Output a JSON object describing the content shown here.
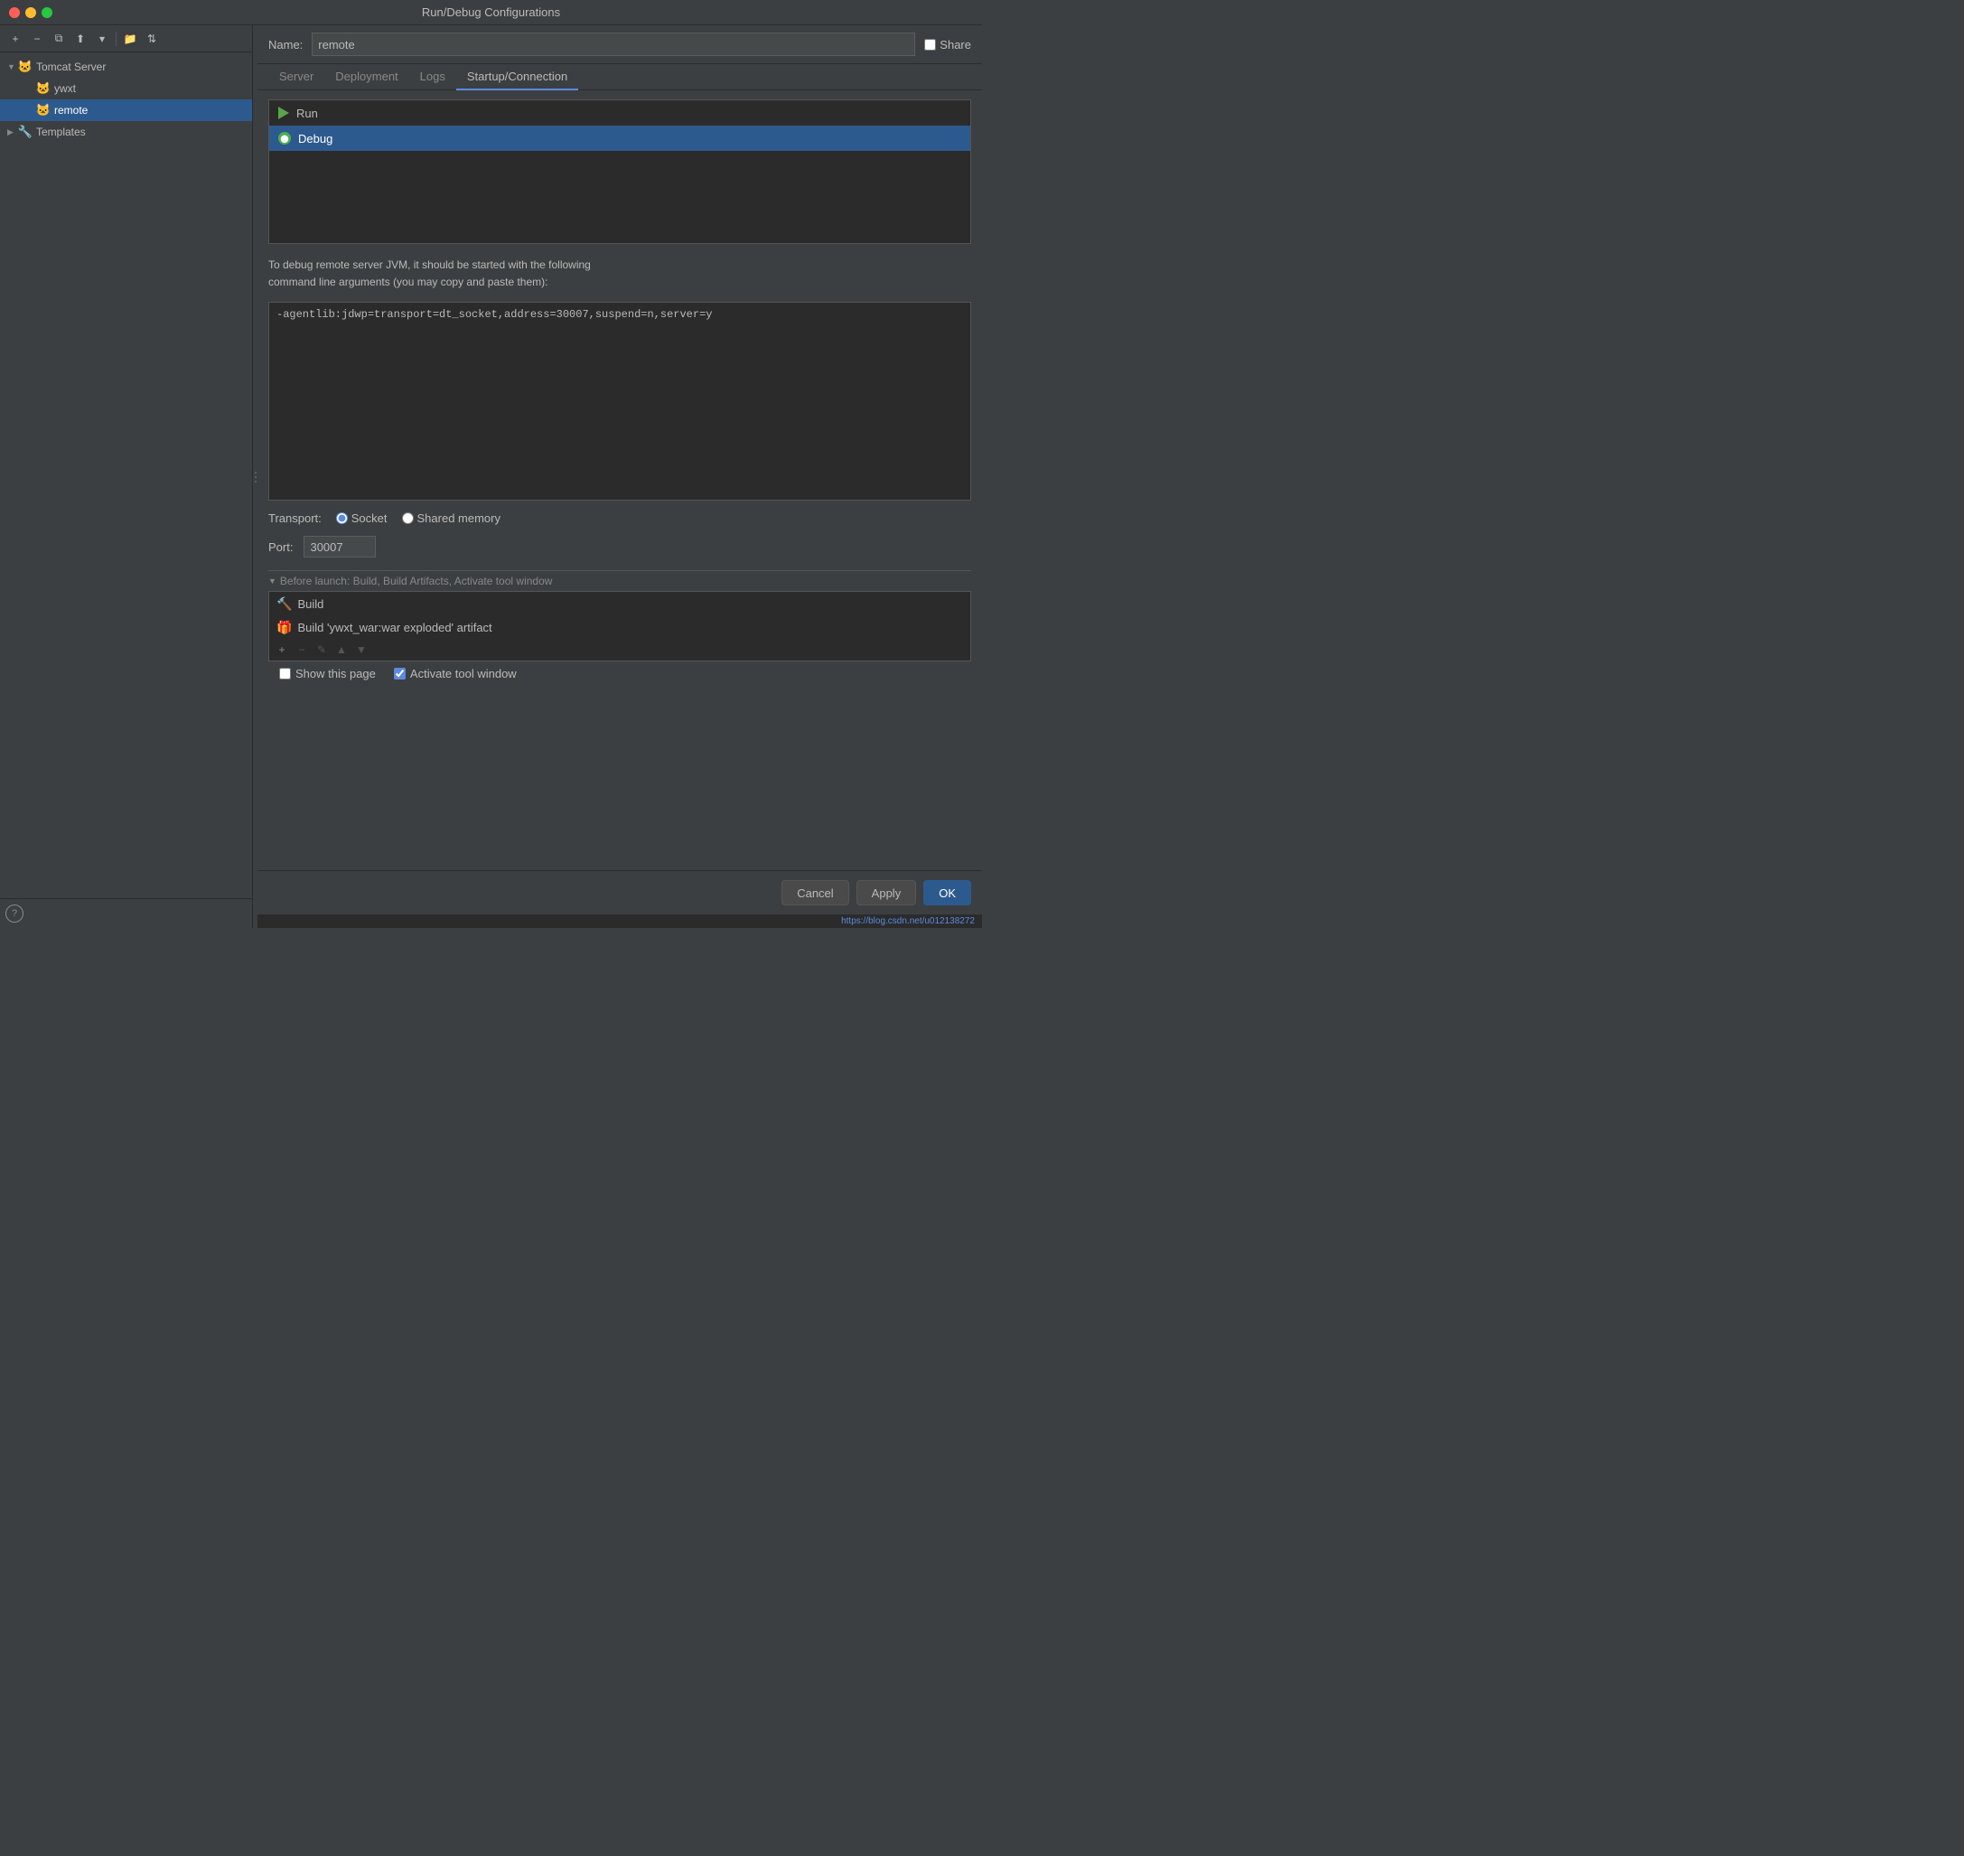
{
  "window": {
    "title": "Run/Debug Configurations"
  },
  "sidebar": {
    "toolbar_buttons": [
      {
        "id": "add",
        "label": "+",
        "icon": "plus-icon"
      },
      {
        "id": "remove",
        "label": "−",
        "icon": "minus-icon"
      },
      {
        "id": "copy",
        "label": "⧉",
        "icon": "copy-icon"
      },
      {
        "id": "save",
        "label": "↑",
        "icon": "save-icon"
      },
      {
        "id": "dropdown",
        "label": "▾",
        "icon": "dropdown-icon"
      },
      {
        "id": "folder",
        "label": "📁",
        "icon": "folder-icon"
      },
      {
        "id": "sort",
        "label": "⇅",
        "icon": "sort-icon"
      }
    ],
    "tree": {
      "tomcat_group": {
        "label": "Tomcat Server",
        "expanded": true,
        "items": [
          {
            "id": "ywxt",
            "label": "ywxt",
            "selected": false
          },
          {
            "id": "remote",
            "label": "remote",
            "selected": true
          }
        ]
      },
      "templates": {
        "label": "Templates",
        "expanded": false
      }
    }
  },
  "header": {
    "name_label": "Name:",
    "name_value": "remote",
    "share_label": "Share",
    "share_checked": false
  },
  "tabs": {
    "items": [
      {
        "id": "server",
        "label": "Server",
        "active": false
      },
      {
        "id": "deployment",
        "label": "Deployment",
        "active": false
      },
      {
        "id": "logs",
        "label": "Logs",
        "active": false
      },
      {
        "id": "startup",
        "label": "Startup/Connection",
        "active": true
      }
    ]
  },
  "startup_connection": {
    "run_debug_items": [
      {
        "id": "run",
        "label": "Run",
        "type": "run",
        "selected": false
      },
      {
        "id": "debug",
        "label": "Debug",
        "type": "debug",
        "selected": true
      }
    ],
    "description_line1": "To debug remote server JVM, it should be started with the following",
    "description_line2": "command line arguments (you may copy and paste them):",
    "command_text": "-agentlib:jdwp=transport=dt_socket,address=30007,suspend=n,server=y",
    "transport_label": "Transport:",
    "transport_options": [
      {
        "id": "socket",
        "label": "Socket",
        "selected": true
      },
      {
        "id": "shared_memory",
        "label": "Shared memory",
        "selected": false
      }
    ],
    "port_label": "Port:",
    "port_value": "30007"
  },
  "before_launch": {
    "header": "Before launch: Build, Build Artifacts, Activate tool window",
    "items": [
      {
        "id": "build",
        "label": "Build",
        "icon": "build-icon"
      },
      {
        "id": "build_artifact",
        "label": "Build 'ywxt_war:war exploded' artifact",
        "icon": "artifact-icon"
      }
    ],
    "toolbar_buttons": [
      {
        "id": "add",
        "label": "+",
        "icon": "add-icon",
        "disabled": false
      },
      {
        "id": "remove",
        "label": "−",
        "icon": "remove-icon",
        "disabled": true
      },
      {
        "id": "edit",
        "label": "✎",
        "icon": "edit-icon",
        "disabled": true
      },
      {
        "id": "up",
        "label": "▲",
        "icon": "up-icon",
        "disabled": true
      },
      {
        "id": "down",
        "label": "▼",
        "icon": "down-icon",
        "disabled": true
      }
    ],
    "show_this_page": {
      "label": "Show this page",
      "checked": false
    },
    "activate_tool_window": {
      "label": "Activate tool window",
      "checked": true
    }
  },
  "buttons": {
    "cancel": "Cancel",
    "apply": "Apply",
    "ok": "OK"
  },
  "url_bar": {
    "url": "https://blog.csdn.net/u012138272"
  }
}
